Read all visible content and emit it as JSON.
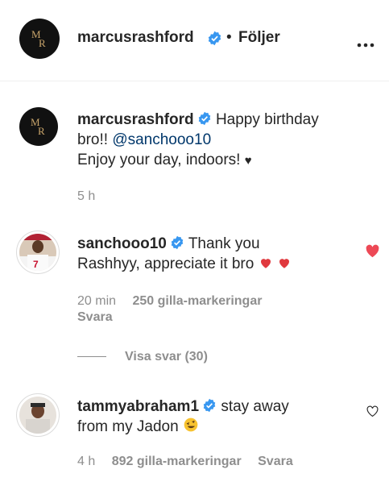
{
  "header": {
    "username": "marcusrashford",
    "follow_label": "Följer",
    "dot": "•"
  },
  "caption": {
    "username": "marcusrashford",
    "text_part1": "Happy birthday",
    "text_part2": "bro!!",
    "mention": "@sanchooo10",
    "text_line3": "Enjoy your day, indoors!",
    "heart": "♥",
    "time": "5 h"
  },
  "comments": [
    {
      "username": "sanchooo10",
      "text_part1": "Thank you",
      "text_part2": "Rashhyy, appreciate it bro",
      "time": "20 min",
      "likes": "250 gilla-markeringar",
      "reply_label": "Svara",
      "view_replies": "Visa svar (30)",
      "liked": true
    },
    {
      "username": "tammyabraham1",
      "text_part1": "stay away",
      "text_part2": "from my Jadon",
      "time": "4 h",
      "likes": "892 gilla-markeringar",
      "reply_label": "Svara",
      "liked": false
    }
  ],
  "colors": {
    "verified_blue": "#3897f0",
    "like_red": "#ed4956",
    "muted_gray": "#8e8e8e"
  },
  "icons": {
    "more": "more-options-icon",
    "verified": "verified-badge-icon",
    "heart_filled": "heart-filled-icon",
    "heart_outline": "heart-outline-icon"
  }
}
